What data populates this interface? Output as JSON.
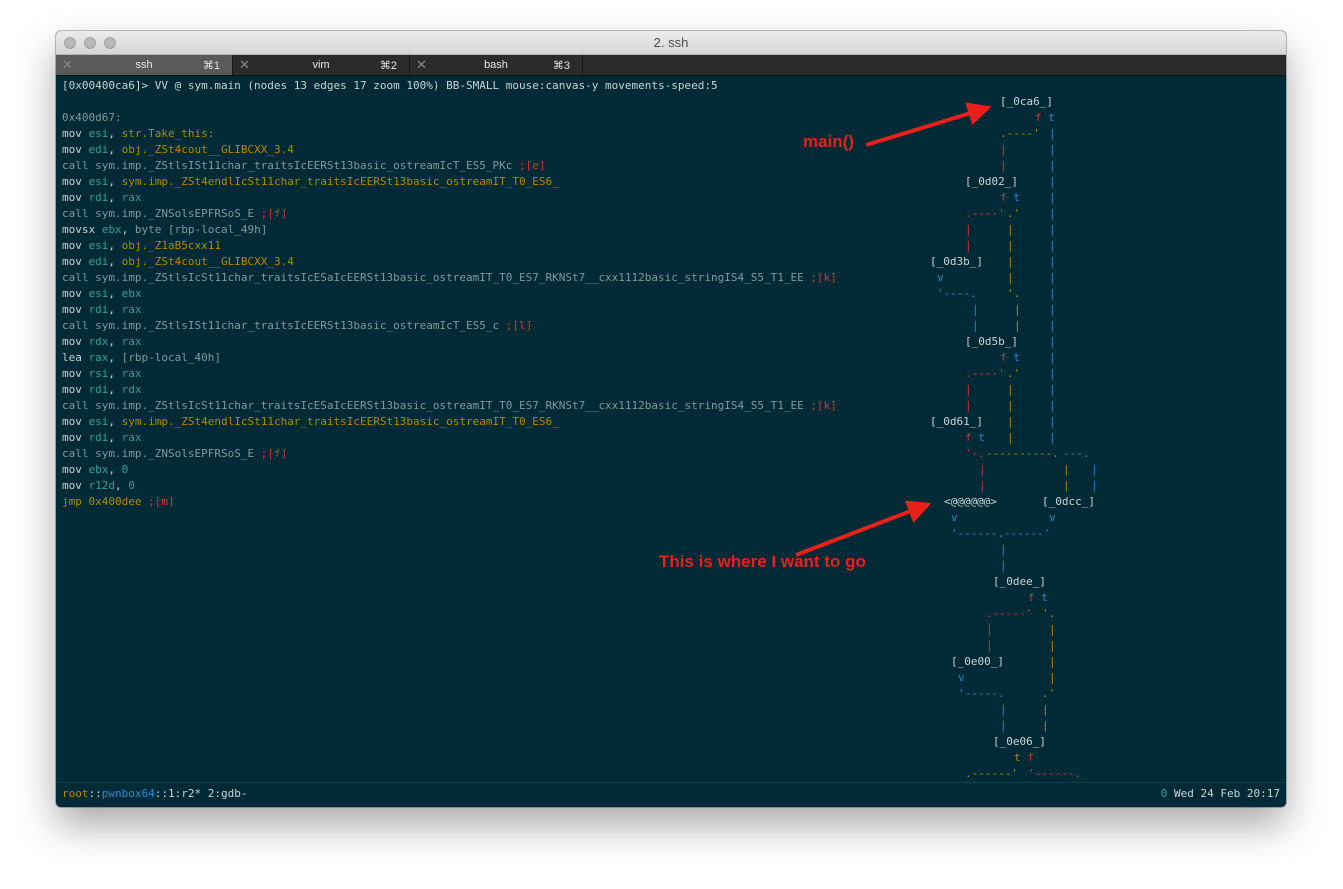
{
  "window": {
    "title": "2. ssh",
    "tabs": [
      {
        "label": "ssh",
        "shortcut": "⌘1"
      },
      {
        "label": "vim",
        "shortcut": "⌘2"
      },
      {
        "label": "bash",
        "shortcut": "⌘3"
      }
    ]
  },
  "terminal": {
    "header": "[0x00400ca6]> VV @ sym.main (nodes 13 edges 17 zoom 100%) BB-SMALL mouse:canvas-y movements-speed:5",
    "addr": "0x400d67:",
    "lines": [
      {
        "op": "mov",
        "a1": "esi",
        "sep": ", ",
        "a2": "str.Take_this:",
        "ref": ""
      },
      {
        "op": "mov",
        "a1": "edi",
        "sep": ", ",
        "a2": "obj._ZSt4cout__GLIBCXX_3.4",
        "ref": ""
      },
      {
        "op": "call",
        "a1": "sym.imp._ZStlsISt11char_traitsIcEERSt13basic_ostreamIcT_ES5_PKc",
        "sep": "",
        "a2": "",
        "ref": " ;[e]"
      },
      {
        "op": "mov",
        "a1": "esi",
        "sep": ", ",
        "a2": "sym.imp._ZSt4endlIcSt11char_traitsIcEERSt13basic_ostreamIT_T0_ES6_",
        "ref": ""
      },
      {
        "op": "mov",
        "a1": "rdi",
        "sep": ", ",
        "a2": "rax",
        "ref": ""
      },
      {
        "op": "call",
        "a1": "sym.imp._ZNSolsEPFRSoS_E",
        "sep": "",
        "a2": "",
        "ref": " ;[f]"
      },
      {
        "op": "movsx",
        "a1": "ebx",
        "sep": ", ",
        "a2": "byte [rbp-local_49h]",
        "ref": ""
      },
      {
        "op": "mov",
        "a1": "esi",
        "sep": ", ",
        "a2": "obj._Z1aB5cxx11",
        "ref": ""
      },
      {
        "op": "mov",
        "a1": "edi",
        "sep": ", ",
        "a2": "obj._ZSt4cout__GLIBCXX_3.4",
        "ref": ""
      },
      {
        "op": "call",
        "a1": "sym.imp._ZStlsIcSt11char_traitsIcESaIcEERSt13basic_ostreamIT_T0_ES7_RKNSt7__cxx1112basic_stringIS4_S5_T1_EE",
        "sep": "",
        "a2": "",
        "ref": " ;[k]"
      },
      {
        "op": "mov",
        "a1": "esi",
        "sep": ", ",
        "a2": "ebx",
        "ref": ""
      },
      {
        "op": "mov",
        "a1": "rdi",
        "sep": ", ",
        "a2": "rax",
        "ref": ""
      },
      {
        "op": "call",
        "a1": "sym.imp._ZStlsISt11char_traitsIcEERSt13basic_ostreamIcT_ES5_c",
        "sep": "",
        "a2": "",
        "ref": " ;[l]"
      },
      {
        "op": "mov",
        "a1": "rdx",
        "sep": ", ",
        "a2": "rax",
        "ref": ""
      },
      {
        "op": "lea",
        "a1": "rax",
        "sep": ", ",
        "a2": "[rbp-local_40h]",
        "ref": ""
      },
      {
        "op": "mov",
        "a1": "rsi",
        "sep": ", ",
        "a2": "rax",
        "ref": ""
      },
      {
        "op": "mov",
        "a1": "rdi",
        "sep": ", ",
        "a2": "rdx",
        "ref": ""
      },
      {
        "op": "call",
        "a1": "sym.imp._ZStlsIcSt11char_traitsIcESaIcEERSt13basic_ostreamIT_T0_ES7_RKNSt7__cxx1112basic_stringIS4_S5_T1_EE",
        "sep": "",
        "a2": "",
        "ref": " ;[k]"
      },
      {
        "op": "mov",
        "a1": "esi",
        "sep": ", ",
        "a2": "sym.imp._ZSt4endlIcSt11char_traitsIcEERSt13basic_ostreamIT_T0_ES6_",
        "ref": ""
      },
      {
        "op": "mov",
        "a1": "rdi",
        "sep": ", ",
        "a2": "rax",
        "ref": ""
      },
      {
        "op": "call",
        "a1": "sym.imp._ZNSolsEPFRSoS_E",
        "sep": "",
        "a2": "",
        "ref": " ;[f]"
      },
      {
        "op": "mov",
        "a1": "ebx",
        "sep": ", ",
        "a2": "0",
        "ref": ""
      },
      {
        "op": "mov",
        "a1": "r12d",
        "sep": ", ",
        "a2": "0",
        "ref": ""
      },
      {
        "op": "jmp",
        "a1": "0x400dee",
        "sep": "",
        "a2": "",
        "ref": " ;[m]"
      }
    ],
    "graph_nodes": [
      "[_0ca6_]",
      "[_0d02_]",
      "[_0d3b_]",
      "[_0d5b_]",
      "[_0d61_]",
      "<@@@@@@>",
      "[_0dcc_]",
      "[_0dee_]",
      "[_0e00_]",
      "[_0e06_]"
    ]
  },
  "annotations": {
    "main": "main()",
    "target": "This is where I want to go"
  },
  "statusbar": {
    "user": "root",
    "sep1": "::",
    "host": "pwnbox64",
    "rest": "::1:r2* 2:gdb-",
    "zero": "0",
    "datetime": "Wed 24 Feb 20:17"
  },
  "colors": {
    "background": "#002b36",
    "arrow": "#e8201a",
    "yellow": "#b58900",
    "red": "#dc322f",
    "blue": "#268bd2",
    "cyan": "#2aa198"
  }
}
